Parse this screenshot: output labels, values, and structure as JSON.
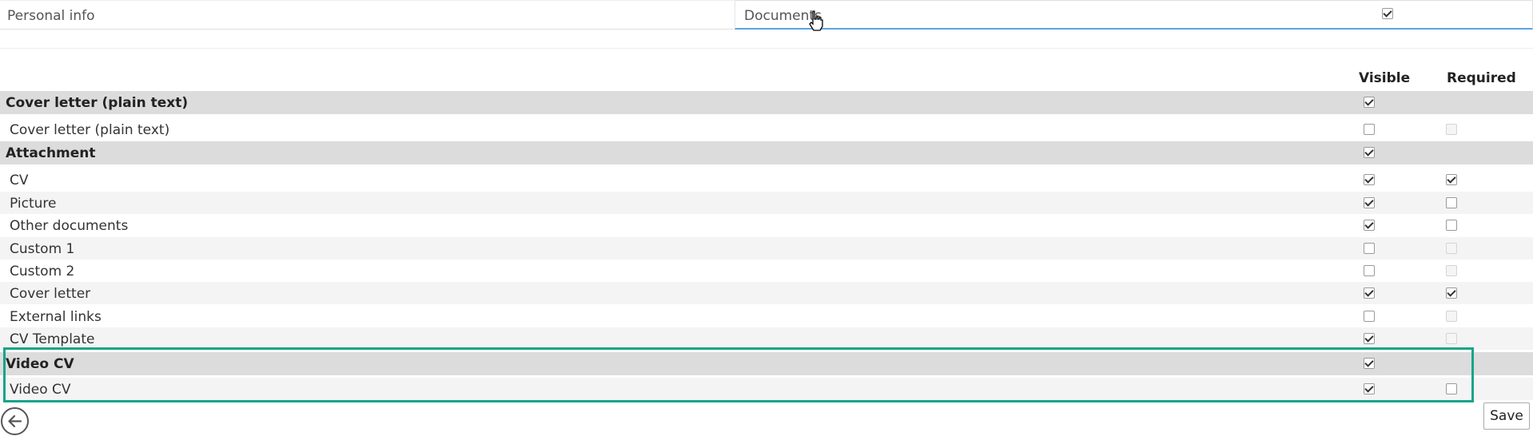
{
  "tabs": {
    "personal_info": "Personal info",
    "documents": "Documents",
    "documents_checked": true
  },
  "columns": {
    "visible": "Visible",
    "required": "Required"
  },
  "rows": [
    {
      "type": "group",
      "label": "Cover letter (plain text)",
      "visible": true,
      "required": null
    },
    {
      "type": "item",
      "label": "Cover letter (plain text)",
      "visible": false,
      "required": false,
      "required_disabled": true
    },
    {
      "type": "group",
      "label": "Attachment",
      "visible": true,
      "required": null
    },
    {
      "type": "item",
      "label": "CV",
      "visible": true,
      "required": true
    },
    {
      "type": "item",
      "label": "Picture",
      "visible": true,
      "required": false
    },
    {
      "type": "item",
      "label": "Other documents",
      "visible": true,
      "required": false
    },
    {
      "type": "item",
      "label": "Custom 1",
      "visible": false,
      "required": false,
      "required_disabled": true
    },
    {
      "type": "item",
      "label": "Custom 2",
      "visible": false,
      "required": false,
      "required_disabled": true
    },
    {
      "type": "item",
      "label": "Cover letter",
      "visible": true,
      "required": true
    },
    {
      "type": "item",
      "label": "External links",
      "visible": false,
      "required": false,
      "required_disabled": true
    },
    {
      "type": "item",
      "label": "CV Template",
      "visible": true,
      "required": false,
      "required_disabled": true
    },
    {
      "type": "group",
      "label": "Video CV",
      "visible": true,
      "required": null
    },
    {
      "type": "item",
      "label": "Video CV",
      "visible": true,
      "required": false
    }
  ],
  "footer": {
    "save_label": "Save",
    "back_icon": "back-arrow-icon"
  },
  "colors": {
    "highlight": "#18a38a",
    "active_tab_underline": "#5ba4e0",
    "group_bg": "#dcdcdc"
  }
}
